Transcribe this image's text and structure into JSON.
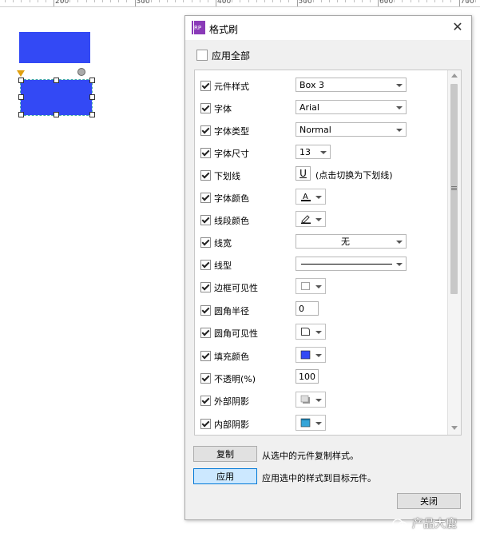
{
  "ruler": {
    "labels": [
      "200",
      "300",
      "400",
      "500",
      "600",
      "700"
    ]
  },
  "dialog": {
    "title": "格式刷",
    "app_icon_text": "RP",
    "close_glyph": "✕",
    "apply_all_label": "应用全部",
    "rows": [
      {
        "label": "元件样式",
        "control": "dropdown",
        "value": "Box 3",
        "checked": true
      },
      {
        "label": "字体",
        "control": "dropdown",
        "value": "Arial",
        "checked": true
      },
      {
        "label": "字体类型",
        "control": "dropdown",
        "value": "Normal",
        "checked": true
      },
      {
        "label": "字体尺寸",
        "control": "dropdown",
        "value": "13",
        "checked": true
      },
      {
        "label": "下划线",
        "control": "toggle",
        "value": "U",
        "hint": "(点击切换为下划线)",
        "checked": true
      },
      {
        "label": "字体颜色",
        "control": "icon-dropdown",
        "icon": "font-color-icon",
        "checked": true
      },
      {
        "label": "线段颜色",
        "control": "icon-dropdown",
        "icon": "pen-icon",
        "checked": true
      },
      {
        "label": "线宽",
        "control": "dropdown",
        "value": "无",
        "checked": true
      },
      {
        "label": "线型",
        "control": "dropdown",
        "value": "",
        "checked": true
      },
      {
        "label": "边框可见性",
        "control": "icon-dropdown",
        "icon": "border-visibility-icon",
        "checked": true
      },
      {
        "label": "圆角半径",
        "control": "input",
        "value": "0",
        "checked": true
      },
      {
        "label": "圆角可见性",
        "control": "icon-dropdown",
        "icon": "corner-visibility-icon",
        "checked": true
      },
      {
        "label": "填充颜色",
        "control": "icon-dropdown",
        "icon": "fill-color-icon",
        "checked": true
      },
      {
        "label": "不透明(%)",
        "control": "input",
        "value": "100",
        "checked": true
      },
      {
        "label": "外部阴影",
        "control": "icon-dropdown",
        "icon": "outer-shadow-icon",
        "checked": true
      },
      {
        "label": "内部阴影",
        "control": "icon-dropdown",
        "icon": "inner-shadow-icon",
        "checked": true
      }
    ],
    "copy_button": "复制",
    "copy_hint": "从选中的元件复制样式。",
    "apply_button": "应用",
    "apply_hint": "应用选中的样式到目标元件。",
    "close_button": "关闭"
  },
  "watermark": "产品大鹿",
  "colors": {
    "shape_fill": "#3349f5",
    "accent": "#0078d7",
    "app_icon": "#8a3ab8"
  }
}
